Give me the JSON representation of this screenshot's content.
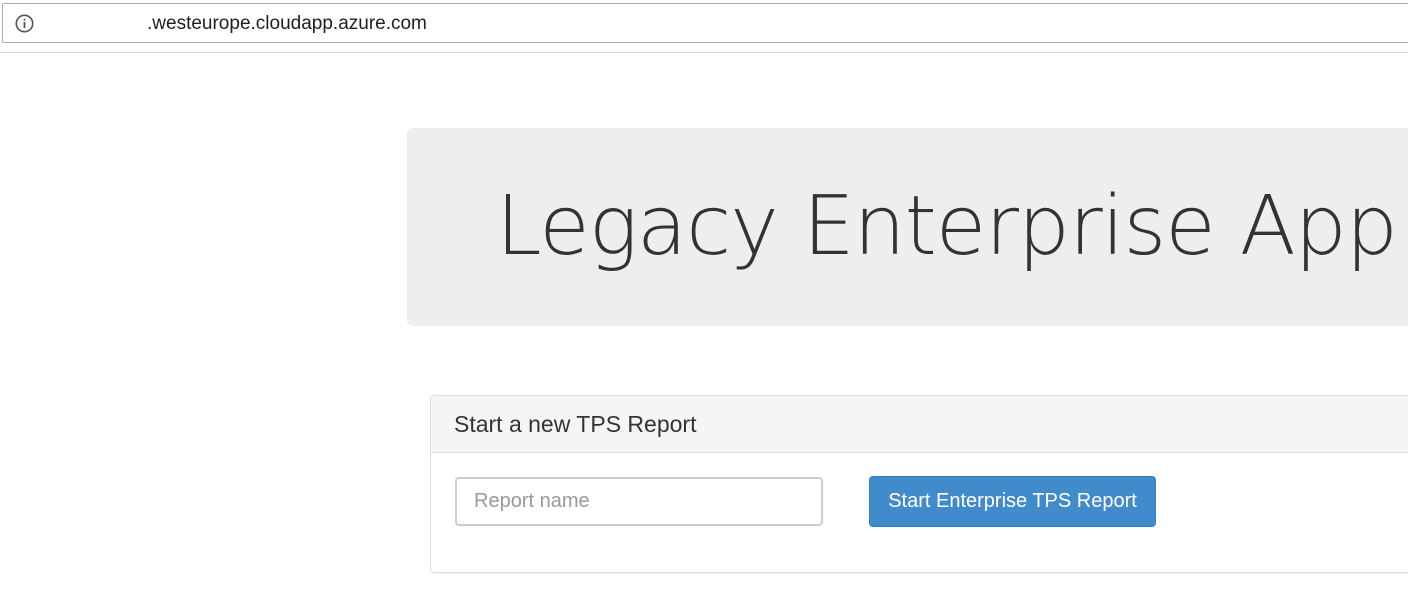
{
  "browser": {
    "url": ".westeurope.cloudapp.azure.com",
    "info_icon": "info-circle-icon"
  },
  "jumbotron": {
    "title": "Legacy Enterprise App"
  },
  "panel": {
    "heading": "Start a new TPS Report",
    "input": {
      "value": "",
      "placeholder": "Report name"
    },
    "button_label": "Start Enterprise TPS Report"
  },
  "colors": {
    "primary_button": "#428bca",
    "jumbotron_bg": "#eeeeee",
    "panel_heading_bg": "#f5f5f5"
  }
}
